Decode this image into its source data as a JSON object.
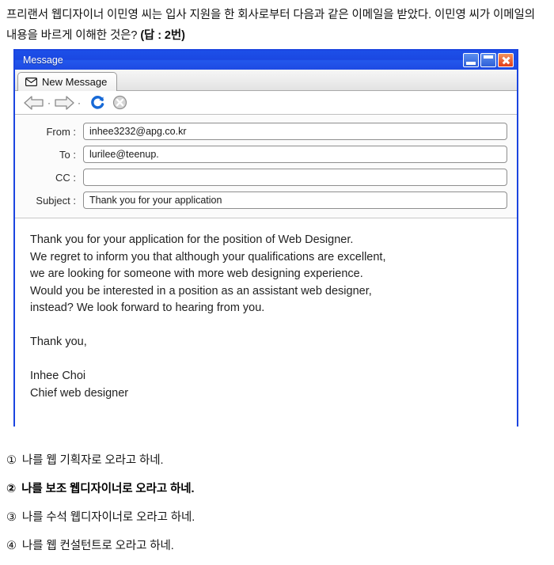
{
  "question": {
    "line1": "프리랜서 웹디자이너 이민영 씨는 입사 지원을 한 회사로부터 다음과 같은 이메일을",
    "line2_main": "받았다. 이민영 씨가 이메일의 내용을 바르게 이해한 것은? ",
    "answer_key": "(답 : 2번)"
  },
  "window": {
    "title": "Message",
    "buttons": {
      "minimize": "minimize-button",
      "maximize": "maximize-button",
      "close": "close-button"
    },
    "tab": {
      "label": "New Message",
      "icon": "envelope-icon"
    },
    "toolbar": {
      "back": "back-arrow-icon",
      "back_dropdown": "·",
      "forward": "forward-arrow-icon",
      "forward_dropdown": "·",
      "refresh": "refresh-icon",
      "stop": "stop-icon"
    },
    "fields": [
      {
        "label": "From :",
        "value": "inhee3232@apg.co.kr",
        "name": "from"
      },
      {
        "label": "To :",
        "value": "lurilee@teenup.",
        "name": "to"
      },
      {
        "label": "CC :",
        "value": "",
        "name": "cc"
      },
      {
        "label": "Subject :",
        "value": "Thank you for your application",
        "name": "subject"
      }
    ],
    "body": {
      "paragraph1": "Thank you for your application for the position of Web Designer.\nWe regret to inform you that although your qualifications are excellent,\nwe are looking for someone with more web designing experience.\nWould you be interested in a position as an assistant web designer,\ninstead? We look forward to hearing from you.",
      "closing": "Thank you,",
      "signature_name": "Inhee Choi",
      "signature_title": "Chief web designer"
    }
  },
  "choices": [
    {
      "num": "①",
      "text": "나를 웹 기획자로 오라고 하네.",
      "correct": false
    },
    {
      "num": "②",
      "text": "나를 보조 웹디자이너로 오라고 하네.",
      "correct": true
    },
    {
      "num": "③",
      "text": "나를 수석 웹디자이너로 오라고 하네.",
      "correct": false
    },
    {
      "num": "④",
      "text": "나를 웹 컨설턴트로 오라고 하네.",
      "correct": false
    }
  ],
  "colors": {
    "window_border": "#1b45e0",
    "titlebar": "#1c4fe8",
    "close_button": "#e33d1a",
    "refresh_icon": "#1769d6"
  }
}
